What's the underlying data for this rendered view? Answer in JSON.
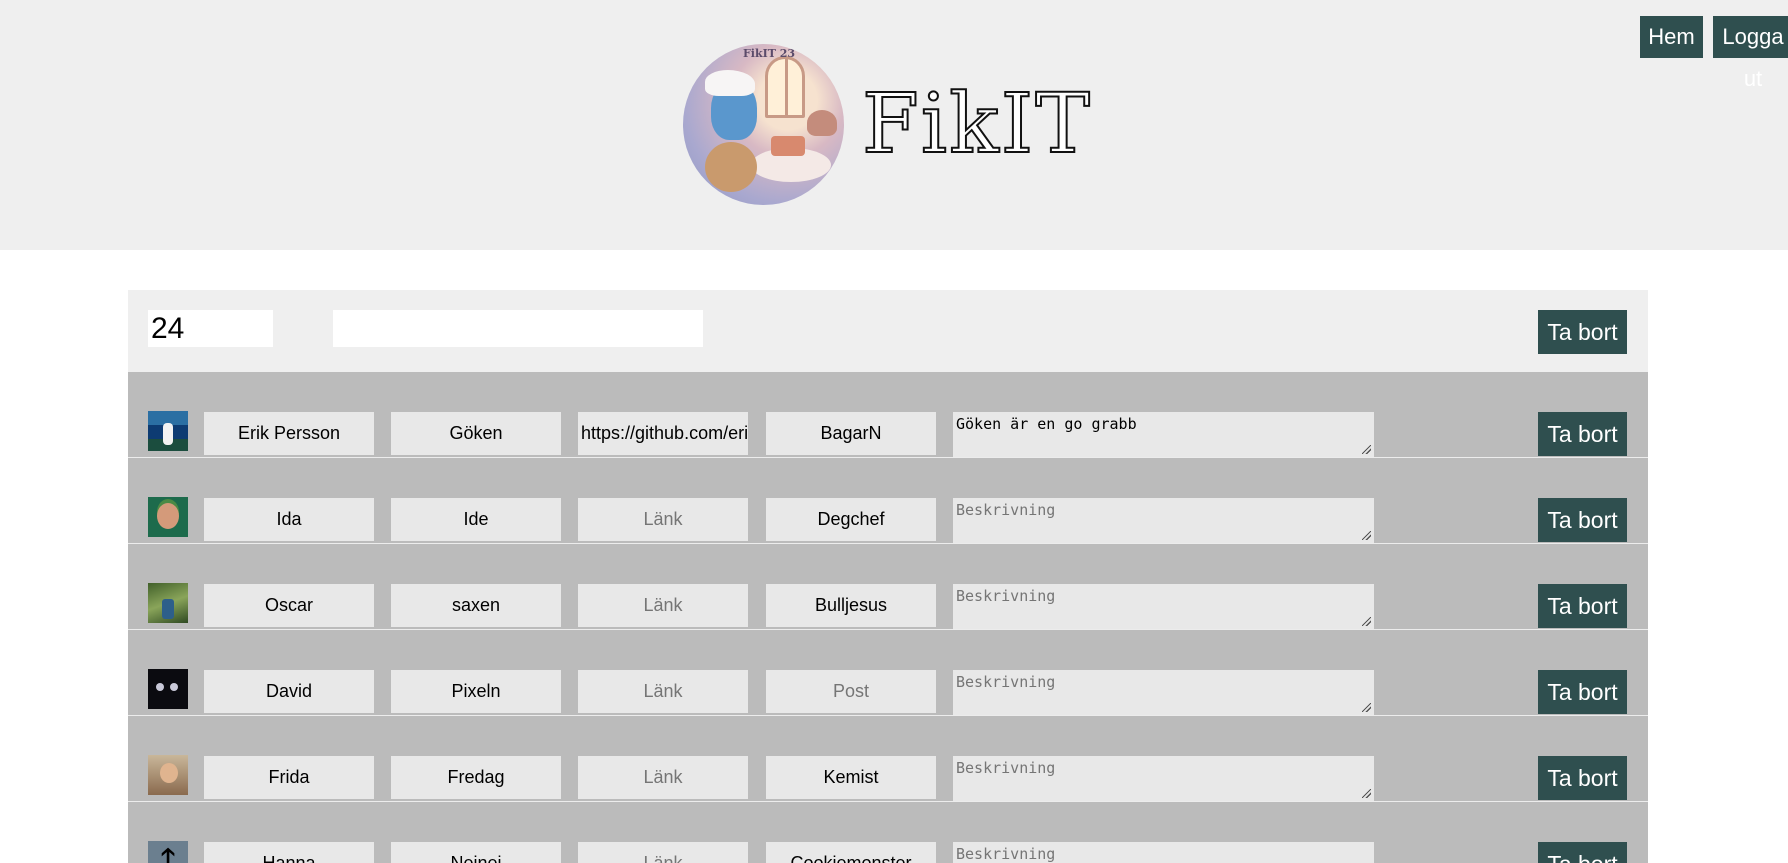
{
  "header": {
    "brand": "FikIT",
    "logo_text": "FikIT 23",
    "nav": {
      "home": "Hem",
      "logout": "Logga ut"
    }
  },
  "group": {
    "year": "24",
    "name": "",
    "delete_label": "Ta bort"
  },
  "placeholders": {
    "link": "Länk",
    "role": "Post",
    "description": "Beskrivning"
  },
  "members": [
    {
      "name": "Erik Persson",
      "nick": "Göken",
      "link": "https://github.com/erikpersson",
      "role": "BagarN",
      "description": "Göken är en go grabb",
      "delete_label": "Ta bort"
    },
    {
      "name": "Ida",
      "nick": "Ide",
      "link": "",
      "role": "Degchef",
      "description": "",
      "delete_label": "Ta bort"
    },
    {
      "name": "Oscar",
      "nick": "saxen",
      "link": "",
      "role": "Bulljesus",
      "description": "",
      "delete_label": "Ta bort"
    },
    {
      "name": "David",
      "nick": "Pixeln",
      "link": "",
      "role": "",
      "description": "",
      "delete_label": "Ta bort"
    },
    {
      "name": "Frida",
      "nick": "Fredag",
      "link": "",
      "role": "Kemist",
      "description": "",
      "delete_label": "Ta bort"
    },
    {
      "name": "Hanna",
      "nick": "Nejnej",
      "link": "",
      "role": "Cookiemonster",
      "description": "",
      "delete_label": "Ta bort",
      "avatar_symbol": "🡑"
    }
  ],
  "colors": {
    "header_bg": "#efefef",
    "list_bg": "#bbbbbb",
    "button_bg": "#2f4f4f",
    "field_bg": "#e8e8e8"
  }
}
